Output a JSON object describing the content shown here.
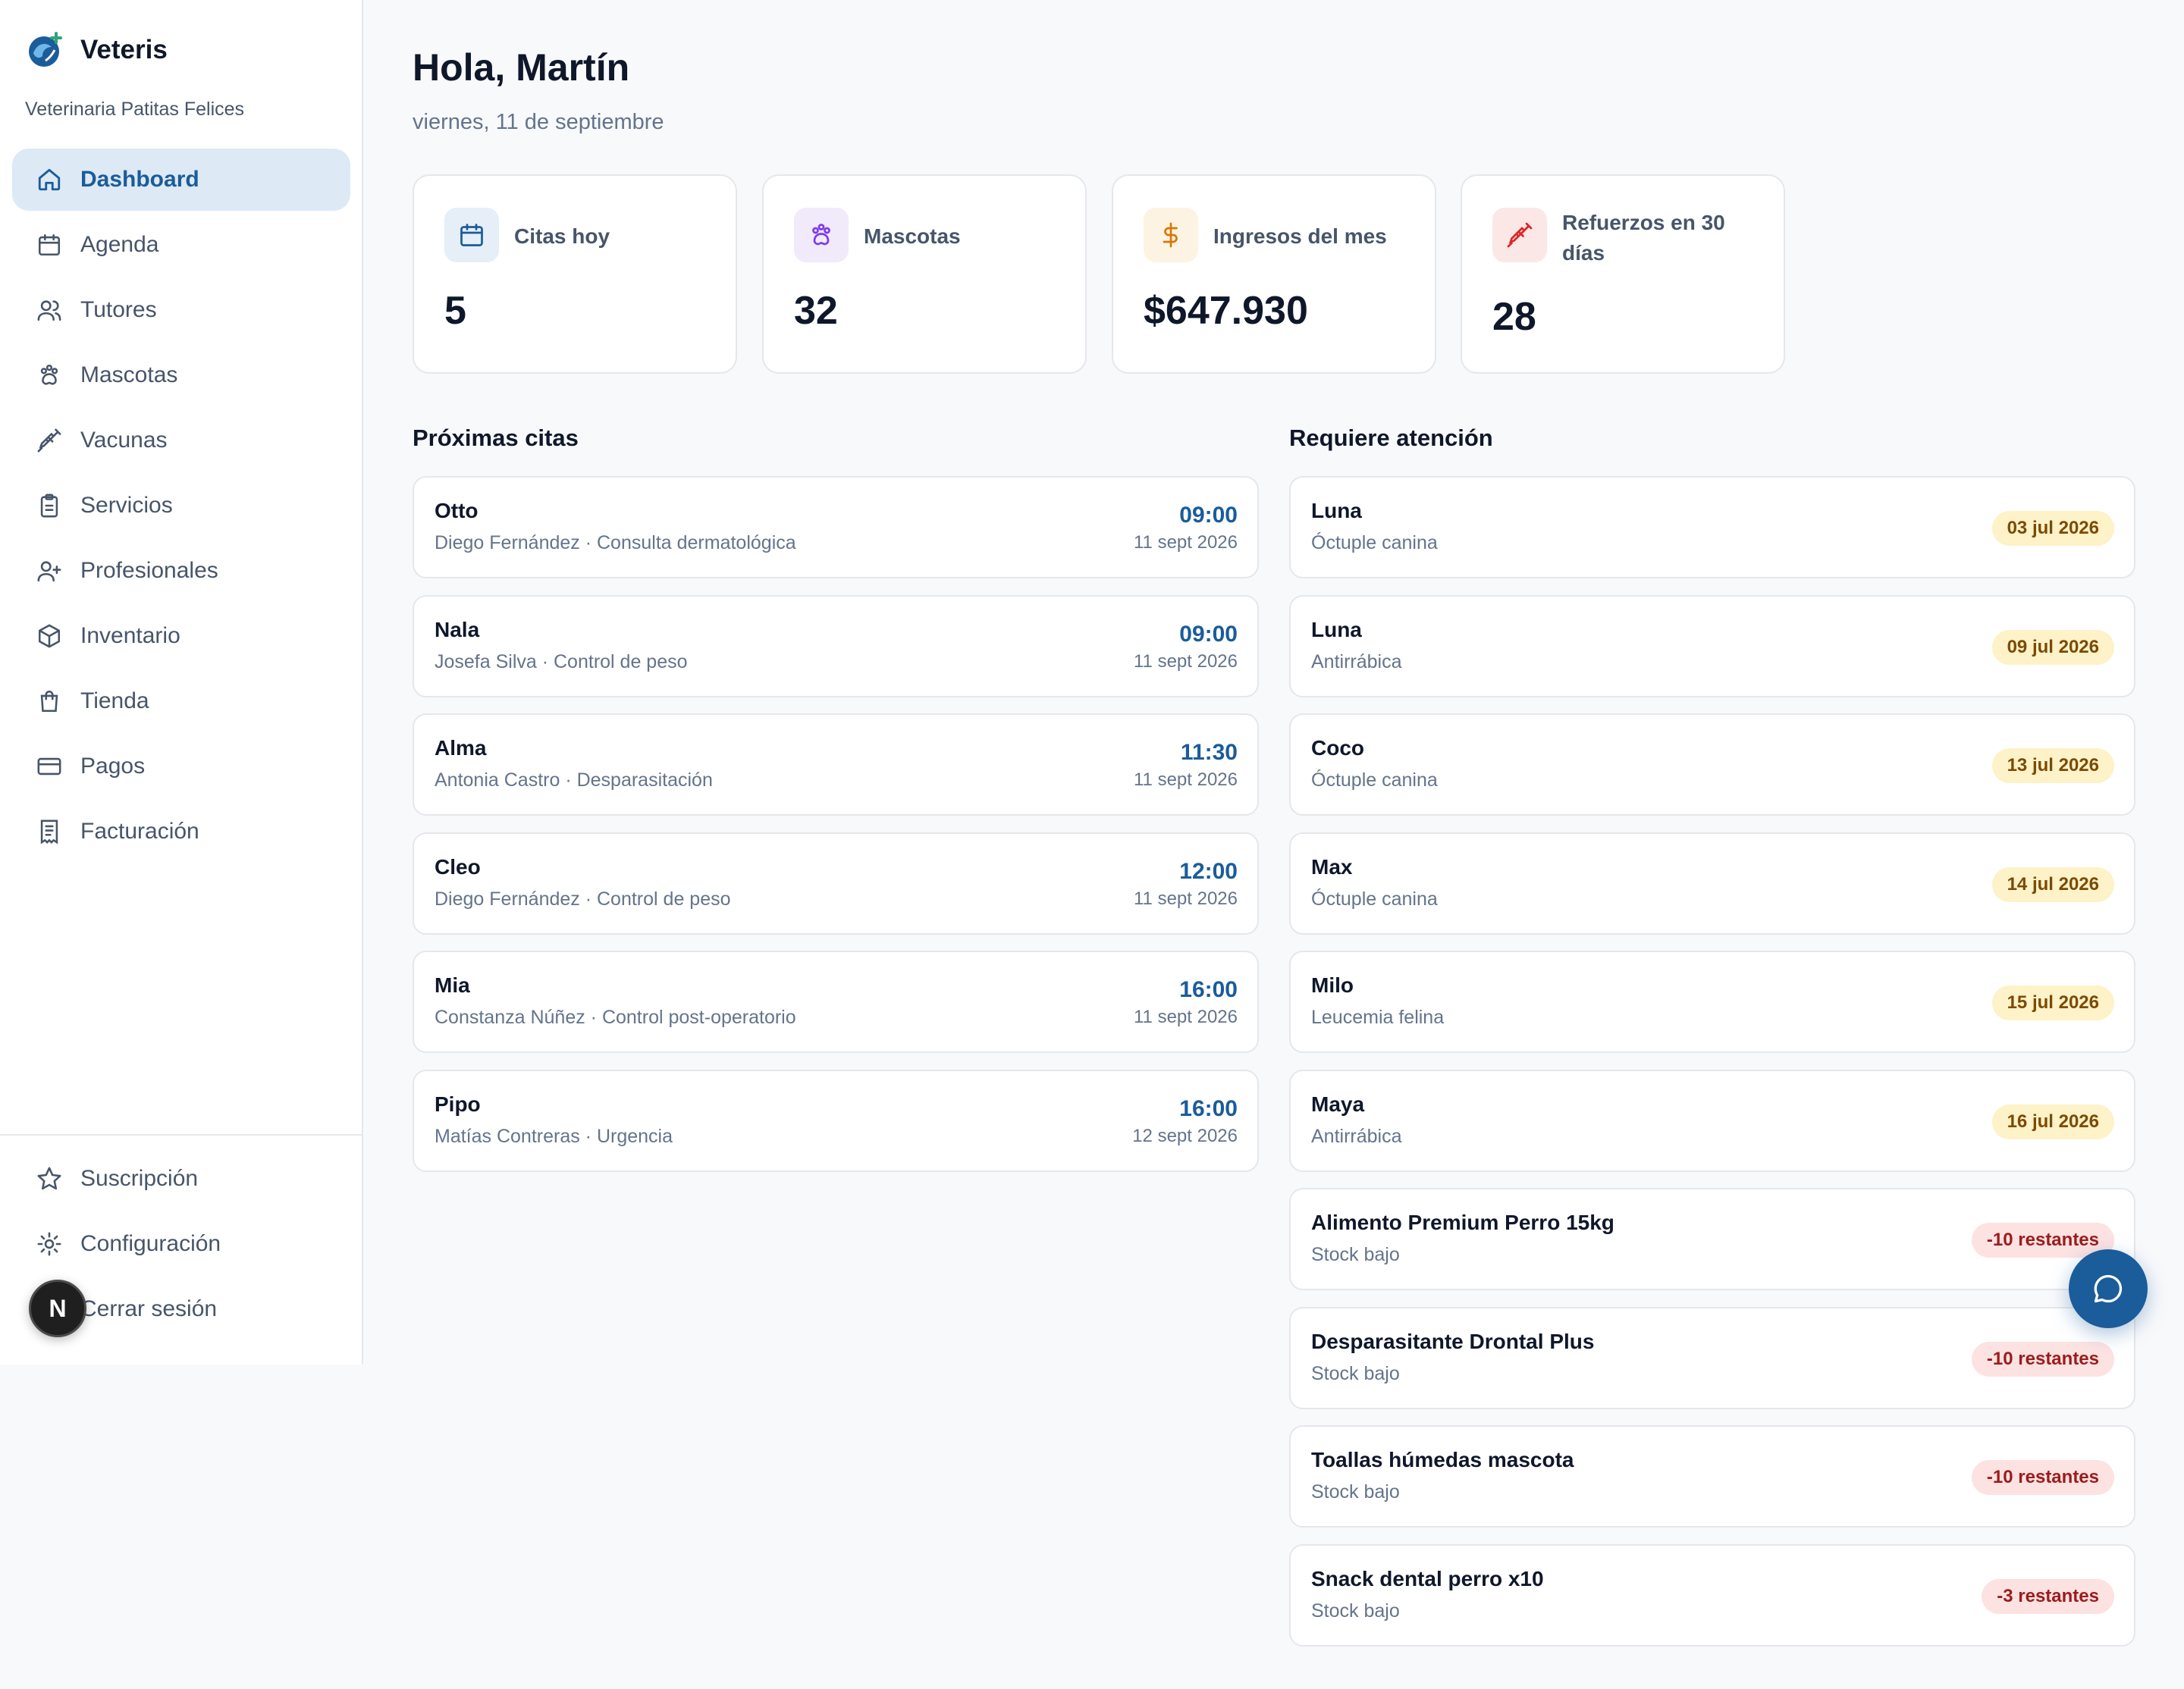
{
  "app": {
    "name": "Veteris",
    "clinic": "Veterinaria Patitas Felices"
  },
  "nav": {
    "items": [
      {
        "label": "Dashboard",
        "icon": "home-icon",
        "active": true
      },
      {
        "label": "Agenda",
        "icon": "calendar-icon"
      },
      {
        "label": "Tutores",
        "icon": "users-icon"
      },
      {
        "label": "Mascotas",
        "icon": "paw-icon"
      },
      {
        "label": "Vacunas",
        "icon": "syringe-icon"
      },
      {
        "label": "Servicios",
        "icon": "clipboard-icon"
      },
      {
        "label": "Profesionales",
        "icon": "user-plus-icon"
      },
      {
        "label": "Inventario",
        "icon": "box-icon"
      },
      {
        "label": "Tienda",
        "icon": "shopping-bag-icon"
      },
      {
        "label": "Pagos",
        "icon": "credit-card-icon"
      },
      {
        "label": "Facturación",
        "icon": "receipt-icon"
      }
    ],
    "bottom": [
      {
        "label": "Suscripción",
        "icon": "star-icon"
      },
      {
        "label": "Configuración",
        "icon": "gear-icon"
      },
      {
        "label": "Cerrar sesión",
        "icon": "logout-icon"
      }
    ]
  },
  "avatar_letter": "N",
  "header": {
    "greeting": "Hola, Martín",
    "date": "viernes, 11 de septiembre"
  },
  "stats": [
    {
      "label": "Citas hoy",
      "value": "5",
      "icon": "calendar-icon",
      "color": "#1b5c9a"
    },
    {
      "label": "Mascotas",
      "value": "32",
      "icon": "paw-icon",
      "color": "#7c3aed"
    },
    {
      "label": "Ingresos del mes",
      "value": "$647.930",
      "icon": "dollar-icon",
      "color": "#d97706"
    },
    {
      "label": "Refuerzos en 30 días",
      "value": "28",
      "icon": "syringe-icon",
      "color": "#dc2626"
    }
  ],
  "upcoming": {
    "title": "Próximas citas",
    "items": [
      {
        "pet": "Otto",
        "detail": "Diego Fernández · Consulta dermatológica",
        "time": "09:00",
        "date": "11 sept 2026"
      },
      {
        "pet": "Nala",
        "detail": "Josefa Silva · Control de peso",
        "time": "09:00",
        "date": "11 sept 2026"
      },
      {
        "pet": "Alma",
        "detail": "Antonia Castro · Desparasitación",
        "time": "11:30",
        "date": "11 sept 2026"
      },
      {
        "pet": "Cleo",
        "detail": "Diego Fernández · Control de peso",
        "time": "12:00",
        "date": "11 sept 2026"
      },
      {
        "pet": "Mia",
        "detail": "Constanza Núñez · Control post-operatorio",
        "time": "16:00",
        "date": "11 sept 2026"
      },
      {
        "pet": "Pipo",
        "detail": "Matías Contreras · Urgencia",
        "time": "16:00",
        "date": "12 sept 2026"
      }
    ]
  },
  "attention": {
    "title": "Requiere atención",
    "items": [
      {
        "name": "Luna",
        "detail": "Óctuple canina",
        "badge": "03 jul 2026",
        "tone": "amber"
      },
      {
        "name": "Luna",
        "detail": "Antirrábica",
        "badge": "09 jul 2026",
        "tone": "amber"
      },
      {
        "name": "Coco",
        "detail": "Óctuple canina",
        "badge": "13 jul 2026",
        "tone": "amber"
      },
      {
        "name": "Max",
        "detail": "Óctuple canina",
        "badge": "14 jul 2026",
        "tone": "amber"
      },
      {
        "name": "Milo",
        "detail": "Leucemia felina",
        "badge": "15 jul 2026",
        "tone": "amber"
      },
      {
        "name": "Maya",
        "detail": "Antirrábica",
        "badge": "16 jul 2026",
        "tone": "amber"
      },
      {
        "name": "Alimento Premium Perro 15kg",
        "detail": "Stock bajo",
        "badge": "-10 restantes",
        "tone": "red"
      },
      {
        "name": "Desparasitante Drontal Plus",
        "detail": "Stock bajo",
        "badge": "-10 restantes",
        "tone": "red"
      },
      {
        "name": "Toallas húmedas mascota",
        "detail": "Stock bajo",
        "badge": "-10 restantes",
        "tone": "red"
      },
      {
        "name": "Snack dental perro x10",
        "detail": "Stock bajo",
        "badge": "-3 restantes",
        "tone": "red"
      }
    ]
  },
  "colors": {
    "primary": "#1b5c9a",
    "active_bg": "#dde9f5"
  }
}
